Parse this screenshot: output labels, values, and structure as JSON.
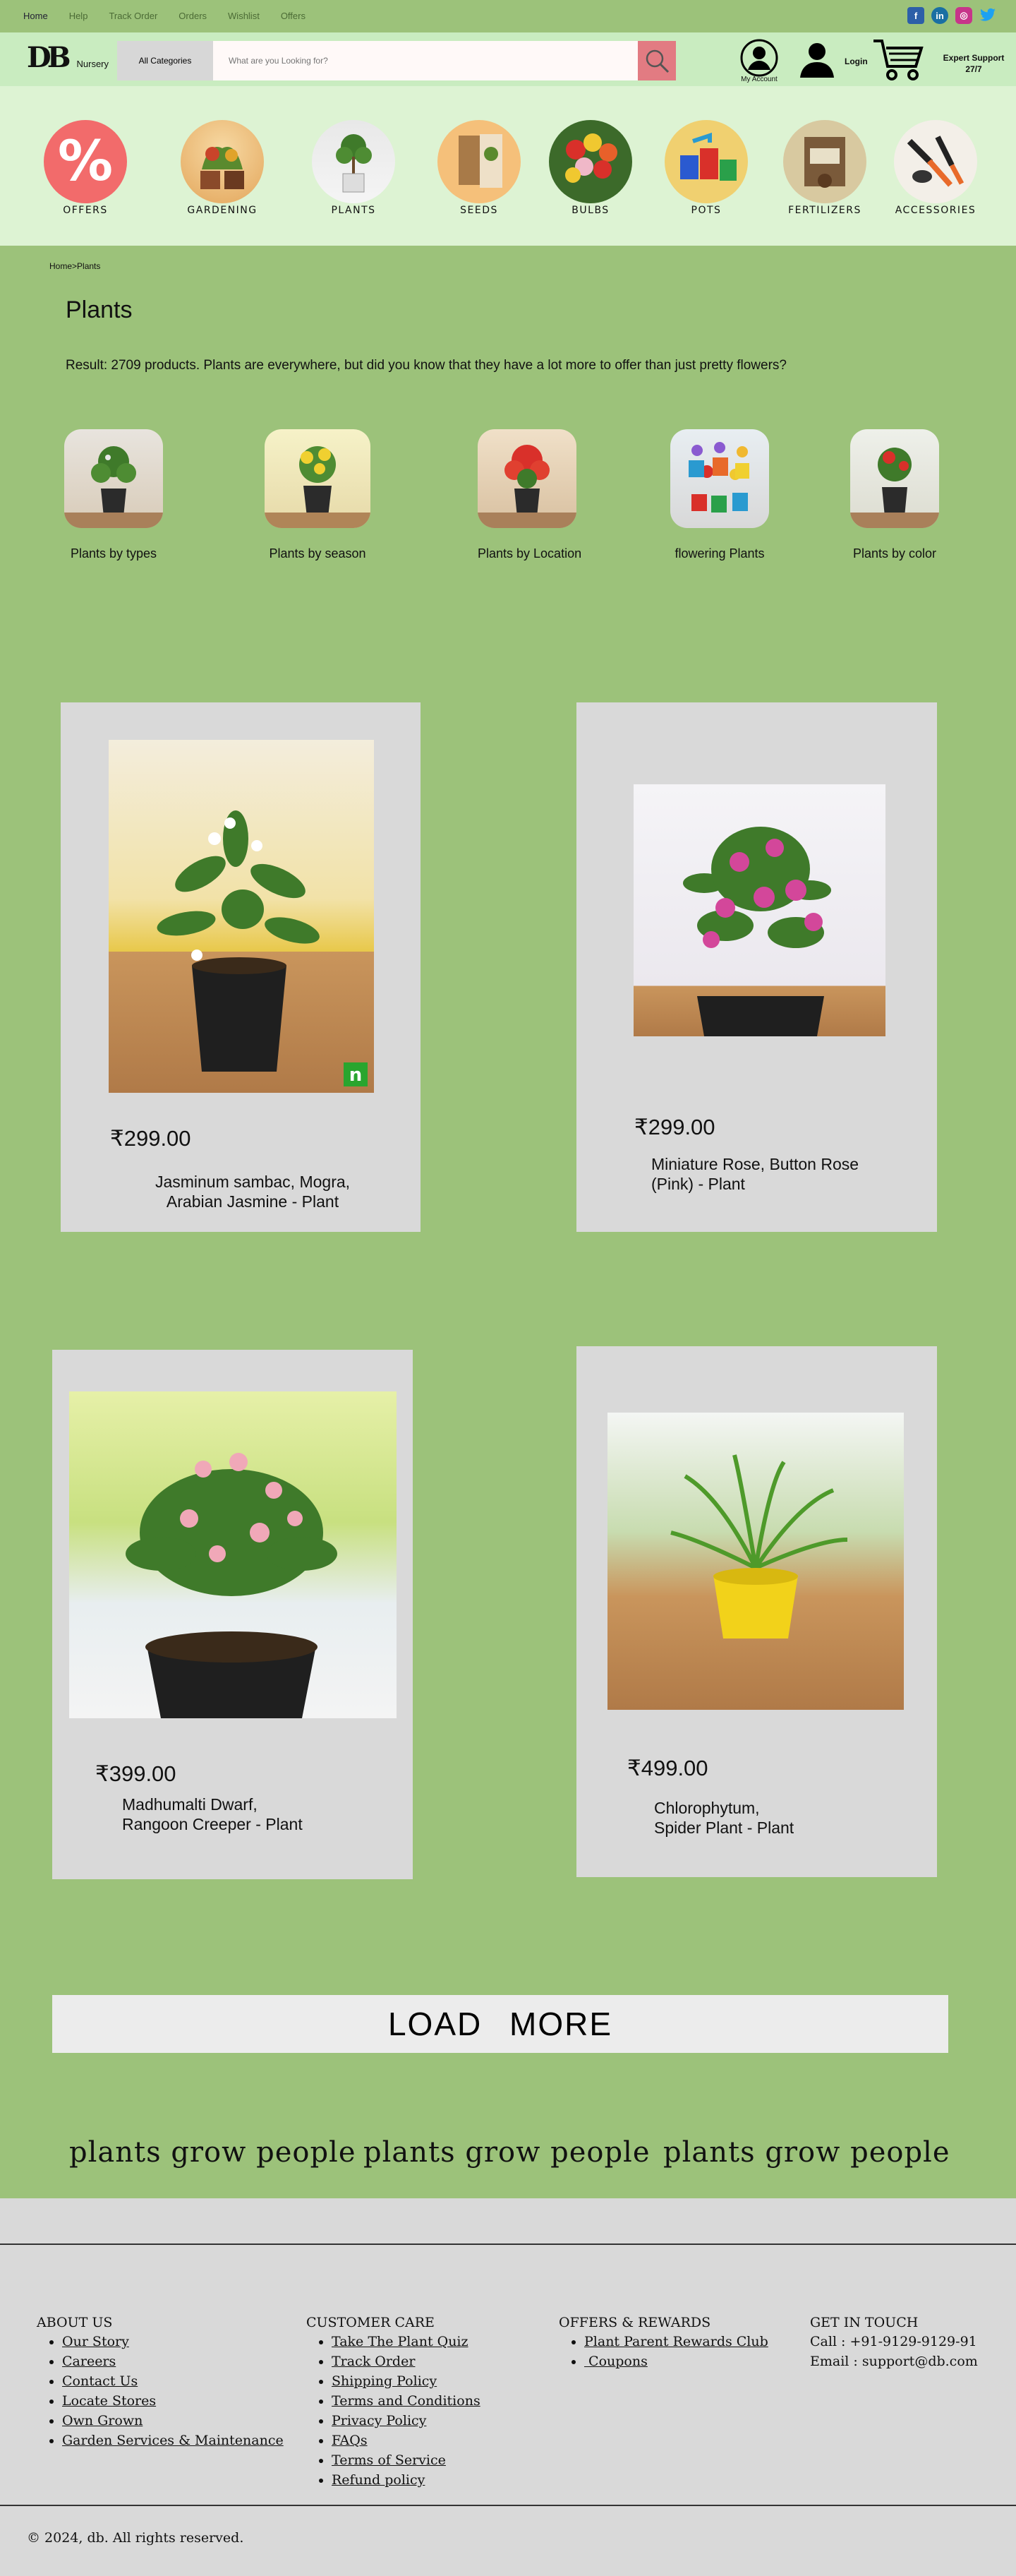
{
  "topnav": {
    "links": [
      "Home",
      "Help",
      "Track Order",
      "Orders",
      "Wishlist",
      "Offers"
    ],
    "socials": [
      {
        "name": "facebook-icon",
        "glyph": "f",
        "color": "#2d5fa8"
      },
      {
        "name": "linkedin-icon",
        "glyph": "in",
        "color": "#1a6fa3"
      },
      {
        "name": "instagram-icon",
        "glyph": "◎",
        "color": "#c7358a"
      },
      {
        "name": "twitter-icon",
        "glyph": "t",
        "color": "#1da1f2"
      }
    ]
  },
  "header": {
    "logo_mark": "DB",
    "logo_sub": "Nursery",
    "category_button": "All Categories",
    "search_placeholder": "What are you Looking for?",
    "account_label": "My Account",
    "login_label": "Login",
    "support_line1": "Expert Support",
    "support_line2": "27/7"
  },
  "categories": [
    "OFFERS",
    "GARDENING",
    "PLANTS",
    "SEEDS",
    "BULBS",
    "POTS",
    "FERTILIZERS",
    "ACCESSORIES"
  ],
  "breadcrumb": "Home>Plants",
  "page_title": "Plants",
  "result_text": "Result: 2709 products. Plants are everywhere, but did you know that they have a lot more to offer than just pretty flowers?",
  "sub_categories": [
    "Plants by types",
    "Plants by season",
    "Plants by Location",
    "flowering Plants",
    "Plants by color"
  ],
  "products": [
    {
      "price": "₹299.00",
      "name": "Jasminum sambac, Mogra, Arabian Jasmine - Plant",
      "name_line1": "Jasminum sambac, Mogra,",
      "name_line2": "Arabian Jasmine - Plant",
      "badge": "n"
    },
    {
      "price": "₹299.00",
      "name": "Miniature Rose, Button Rose (Pink) - Plant",
      "name_line1": "Miniature Rose, Button Rose",
      "name_line2": "(Pink) - Plant"
    },
    {
      "price": "₹399.00",
      "name": "Madhumalti Dwarf, Rangoon Creeper - Plant",
      "name_line1": "Madhumalti Dwarf,",
      "name_line2": "Rangoon Creeper - Plant"
    },
    {
      "price": "₹499.00",
      "name": "Chlorophytum, Spider Plant - Plant",
      "name_line1": "Chlorophytum,",
      "name_line2": "Spider Plant - Plant"
    }
  ],
  "load_more": "LOAD MORE",
  "marquee": [
    "plants grow people",
    "plants grow people",
    "plants grow people"
  ],
  "footer": {
    "about": {
      "title": "ABOUT US",
      "items": [
        "Our Story",
        "Careers",
        "Contact Us",
        "Locate Stores",
        "Own Grown",
        "Garden Services & Maintenance"
      ]
    },
    "care": {
      "title": "CUSTOMER CARE",
      "items": [
        "Take The Plant Quiz",
        "Track Order",
        "Shipping Policy",
        "Terms and Conditions",
        "Privacy Policy",
        "FAQs",
        "Terms of Service",
        "Refund policy"
      ]
    },
    "offers": {
      "title": "OFFERS & REWARDS",
      "items": [
        "Plant Parent Rewards Club",
        " Coupons"
      ]
    },
    "contact": {
      "title": "GET IN TOUCH",
      "call": "Call : +91-9129-9129-91",
      "email": "Email : support@db.com"
    },
    "copyright": "© 2024, db. All rights reserved."
  },
  "colors": {
    "accent": "#9cc27a",
    "header": "#c9ecc0",
    "strip": "#ddf3d3",
    "card": "#d9d9d9",
    "search_button": "#e27b82"
  }
}
